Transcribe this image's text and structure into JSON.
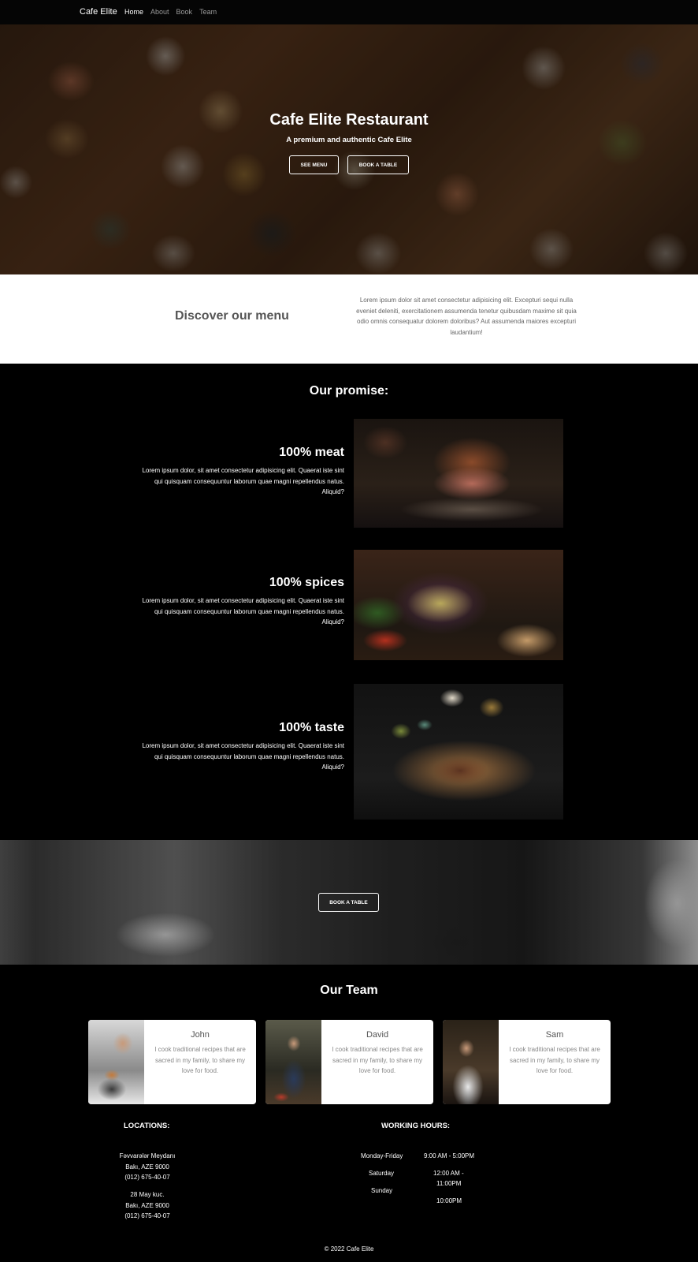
{
  "nav": {
    "brand": "Cafe Elite",
    "links": [
      "Home",
      "About",
      "Book",
      "Team"
    ]
  },
  "hero": {
    "title": "Cafe Elite Restaurant",
    "subtitle": "A premium and authentic Cafe Elite",
    "see_menu": "SEE MENU",
    "book_table": "BOOK A TABLE"
  },
  "discover": {
    "title": "Discover our menu",
    "text": "Lorem ipsum dolor sit amet consectetur adipisicing elit. Excepturi sequi nulla eveniet deleniti, exercitationem assumenda tenetur quibusdam maxime sit quia odio omnis consequatur dolorem doloribus? Aut assumenda maiores excepturi laudantium!"
  },
  "promise": {
    "heading": "Our promise:",
    "items": [
      {
        "title": "100% meat",
        "text": "Lorem ipsum dolor, sit amet consectetur adipisicing elit. Quaerat iste sint qui quisquam consequuntur laborum quae magni repellendus natus. Aliquid?"
      },
      {
        "title": "100% spices",
        "text": "Lorem ipsum dolor, sit amet consectetur adipisicing elit. Quaerat iste sint qui quisquam consequuntur laborum quae magni repellendus natus. Aliquid?"
      },
      {
        "title": "100% taste",
        "text": "Lorem ipsum dolor, sit amet consectetur adipisicing elit. Quaerat iste sint qui quisquam consequuntur laborum quae magni repellendus natus. Aliquid?"
      }
    ]
  },
  "banner": {
    "button": "BOOK A TABLE"
  },
  "team": {
    "heading": "Our Team",
    "members": [
      {
        "name": "John",
        "desc": "I cook traditional recipes that are sacred in my family, to share my love for food."
      },
      {
        "name": "David",
        "desc": "I cook traditional recipes that are sacred in my family, to share my love for food."
      },
      {
        "name": "Sam",
        "desc": "I cook traditional recipes that are sacred in my family, to share my love for food."
      }
    ]
  },
  "locations": {
    "heading": "LOCATIONS:",
    "items": [
      {
        "line1": "Fəvvarələr Meydanı",
        "line2": "Bakı, AZE 9000",
        "line3": "(012) 675-40-07"
      },
      {
        "line1": "28 May kuc.",
        "line2": "Bakı, AZE 9000",
        "line3": "(012) 675-40-07"
      }
    ]
  },
  "hours": {
    "heading": "WORKING HOURS:",
    "days": [
      "Monday-Friday",
      "Saturday",
      "Sunday"
    ],
    "times": [
      "9:00 AM - 5:00PM",
      "12:00 AM -",
      "11:00PM",
      "10:00PM"
    ]
  },
  "footer": {
    "copyright": "© 2022 Cafe Elite"
  }
}
